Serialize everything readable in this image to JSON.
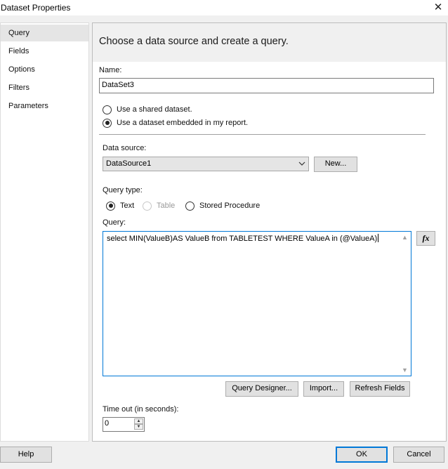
{
  "window": {
    "title": "Dataset Properties",
    "close_icon": "close-icon"
  },
  "nav": {
    "items": [
      {
        "label": "Query",
        "selected": true
      },
      {
        "label": "Fields",
        "selected": false
      },
      {
        "label": "Options",
        "selected": false
      },
      {
        "label": "Filters",
        "selected": false
      },
      {
        "label": "Parameters",
        "selected": false
      }
    ]
  },
  "panel": {
    "heading": "Choose a data source and create a query.",
    "name_label": "Name:",
    "name_value": "DataSet3",
    "dataset_option_shared": "Use a shared dataset.",
    "dataset_option_embedded": "Use a dataset embedded in my report.",
    "dataset_selected": "embedded",
    "datasource_label": "Data source:",
    "datasource_value": "DataSource1",
    "new_button": "New...",
    "querytype_label": "Query type:",
    "querytype_text": "Text",
    "querytype_table": "Table",
    "querytype_sp": "Stored Procedure",
    "querytype_selected": "Text",
    "query_label": "Query:",
    "query_value": "select MIN(ValueB)AS ValueB from TABLETEST WHERE ValueA in (@ValueA)",
    "fx_button": "fx",
    "query_designer_button": "Query Designer...",
    "import_button": "Import...",
    "refresh_fields_button": "Refresh Fields",
    "timeout_label": "Time out (in seconds):",
    "timeout_value": "0"
  },
  "footer": {
    "help_button": "Help",
    "ok_button": "OK",
    "cancel_button": "Cancel"
  },
  "colors": {
    "accent": "#0078d7",
    "window_bg": "#f0f0f0",
    "panel_bg": "#ffffff",
    "nav_selected_bg": "#e5e5e5"
  }
}
